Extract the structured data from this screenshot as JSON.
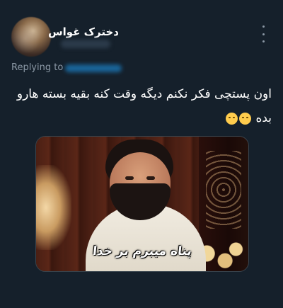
{
  "tweet": {
    "author": {
      "display_name": "دخترک غواس"
    },
    "replying_to_label": "Replying to",
    "text": "اون پستچی فکر نکنم دیگه وقت کنه بقیه بسته هارو بده",
    "emojis": [
      "smiling-face-with-sweat-icon",
      "face-with-tears-of-joy-icon"
    ],
    "media": {
      "caption": "پناه میبرم بر خدا"
    }
  },
  "colors": {
    "background": "#15202b",
    "text_primary": "#ffffff",
    "text_secondary": "#8b98a5",
    "accent": "#1d9bf0"
  }
}
